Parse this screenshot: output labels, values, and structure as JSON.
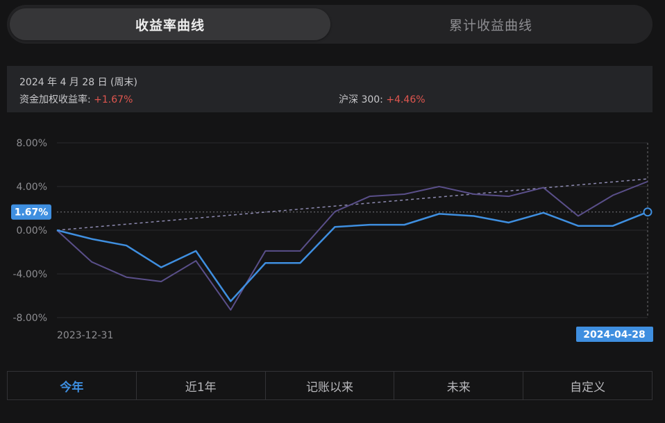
{
  "tabs_top": {
    "active": "收益率曲线",
    "other": "累计收益曲线"
  },
  "info": {
    "date": "2024 年 4 月 28 日 (周末)",
    "fund_label": "资金加权收益率:",
    "fund_value": "+1.67%",
    "index_label": "沪深 300:",
    "index_value": "+4.46%"
  },
  "chart_data": {
    "type": "line",
    "y_ticks": [
      "8.00%",
      "4.00%",
      "0.00%",
      "-4.00%",
      "-8.00%"
    ],
    "ylim": [
      -8,
      8
    ],
    "x_start_label": "2023-12-31",
    "x_end_label": "2024-04-28",
    "current_value_label": "1.67%",
    "series": [
      {
        "values": [
          0.0,
          -0.8,
          -1.4,
          -3.4,
          -1.9,
          -6.5,
          -3.0,
          -3.0,
          0.3,
          0.5,
          0.5,
          1.5,
          1.3,
          0.7,
          1.6,
          0.4,
          0.4,
          1.67
        ],
        "color": "#3f8fe0"
      },
      {
        "values": [
          0.0,
          -2.9,
          -4.3,
          -4.7,
          -2.8,
          -7.3,
          -1.9,
          -1.9,
          1.7,
          3.1,
          3.3,
          4.0,
          3.3,
          3.1,
          3.9,
          1.3,
          3.2,
          4.46
        ],
        "color": "#5a4f8a"
      }
    ],
    "trend_end_value": 4.7,
    "grid": true
  },
  "tabs_bottom": [
    "今年",
    "近1年",
    "记账以来",
    "未来",
    "自定义"
  ],
  "colors": {
    "accent": "#3f8fe0",
    "up": "#e0564f",
    "benchmark": "#5a4f8a"
  }
}
